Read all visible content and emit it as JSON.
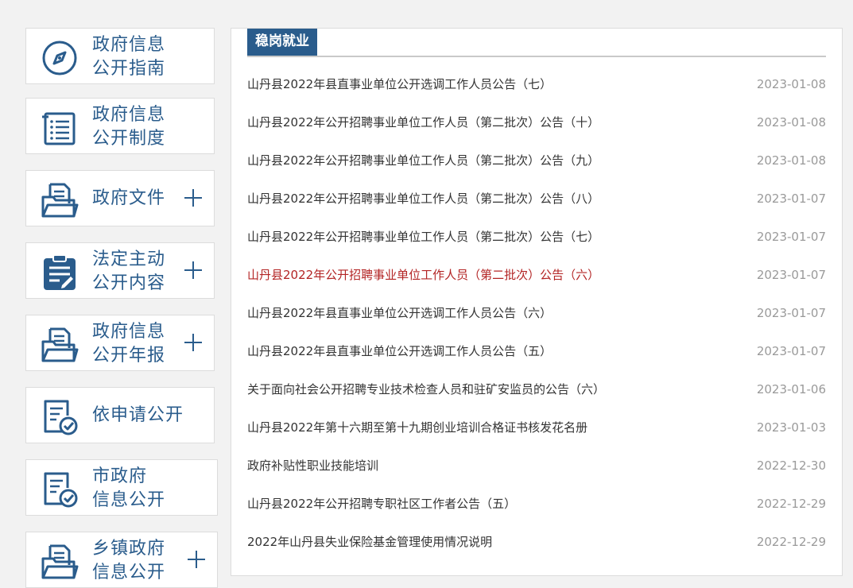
{
  "sidebar": {
    "items": [
      {
        "label_lines": [
          "政府信息",
          "公开指南"
        ],
        "icon": "compass-icon",
        "expandable": false
      },
      {
        "label_lines": [
          "政府信息",
          "公开制度"
        ],
        "icon": "list-document-icon",
        "expandable": false
      },
      {
        "label_lines": [
          "政府文件"
        ],
        "icon": "folder-document-icon",
        "expandable": true
      },
      {
        "label_lines": [
          "法定主动",
          "公开内容"
        ],
        "icon": "clipboard-edit-icon",
        "expandable": true
      },
      {
        "label_lines": [
          "政府信息",
          "公开年报"
        ],
        "icon": "folder-document-icon",
        "expandable": true
      },
      {
        "label_lines": [
          "依申请公开"
        ],
        "icon": "document-check-icon",
        "expandable": false
      },
      {
        "label_lines": [
          "市政府",
          "信息公开"
        ],
        "icon": "document-check-icon",
        "expandable": false
      },
      {
        "label_lines": [
          "乡镇政府",
          "信息公开"
        ],
        "icon": "folder-document-icon",
        "expandable": true
      }
    ]
  },
  "main": {
    "section_title": "稳岗就业",
    "news": [
      {
        "title": "山丹县2022年县直事业单位公开选调工作人员公告（七）",
        "date": "2023-01-08",
        "active": false
      },
      {
        "title": "山丹县2022年公开招聘事业单位工作人员（第二批次）公告（十）",
        "date": "2023-01-08",
        "active": false
      },
      {
        "title": "山丹县2022年公开招聘事业单位工作人员（第二批次）公告（九）",
        "date": "2023-01-08",
        "active": false
      },
      {
        "title": "山丹县2022年公开招聘事业单位工作人员（第二批次）公告（八）",
        "date": "2023-01-07",
        "active": false
      },
      {
        "title": "山丹县2022年公开招聘事业单位工作人员（第二批次）公告（七）",
        "date": "2023-01-07",
        "active": false
      },
      {
        "title": "山丹县2022年公开招聘事业单位工作人员（第二批次）公告（六）",
        "date": "2023-01-07",
        "active": true
      },
      {
        "title": "山丹县2022年县直事业单位公开选调工作人员公告（六）",
        "date": "2023-01-07",
        "active": false
      },
      {
        "title": "山丹县2022年县直事业单位公开选调工作人员公告（五）",
        "date": "2023-01-07",
        "active": false
      },
      {
        "title": "关于面向社会公开招聘专业技术检查人员和驻矿安监员的公告（六）",
        "date": "2023-01-06",
        "active": false
      },
      {
        "title": "山丹县2022年第十六期至第十九期创业培训合格证书核发花名册",
        "date": "2023-01-03",
        "active": false
      },
      {
        "title": "政府补贴性职业技能培训",
        "date": "2022-12-30",
        "active": false
      },
      {
        "title": "山丹县2022年公开招聘专职社区工作者公告（五）",
        "date": "2022-12-29",
        "active": false
      },
      {
        "title": "2022年山丹县失业保险基金管理使用情况说明",
        "date": "2022-12-29",
        "active": false
      }
    ]
  },
  "colors": {
    "accent": "#2a5c8c",
    "active_link": "#b32424",
    "date": "#9a9a9a"
  }
}
